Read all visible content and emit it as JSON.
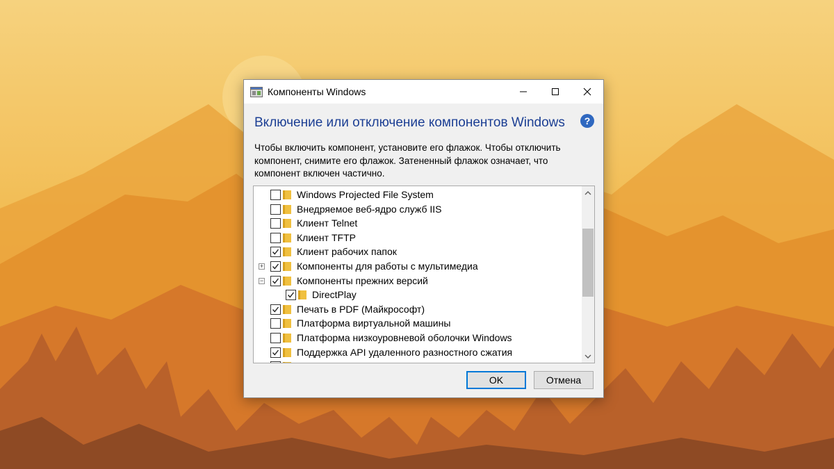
{
  "window": {
    "title": "Компоненты Windows",
    "heading": "Включение или отключение компонентов Windows",
    "description": "Чтобы включить компонент, установите его флажок. Чтобы отключить компонент, снимите его флажок. Затененный флажок означает, что компонент включен частично."
  },
  "features": [
    {
      "label": "Windows Projected File System",
      "checked": false,
      "expander": "",
      "level": 0
    },
    {
      "label": "Внедряемое веб-ядро служб IIS",
      "checked": false,
      "expander": "",
      "level": 0
    },
    {
      "label": "Клиент Telnet",
      "checked": false,
      "expander": "",
      "level": 0
    },
    {
      "label": "Клиент TFTP",
      "checked": false,
      "expander": "",
      "level": 0
    },
    {
      "label": "Клиент рабочих папок",
      "checked": true,
      "expander": "",
      "level": 0
    },
    {
      "label": "Компоненты для работы с мультимедиа",
      "checked": true,
      "expander": "plus",
      "level": 0
    },
    {
      "label": "Компоненты прежних версий",
      "checked": true,
      "expander": "minus",
      "level": 0
    },
    {
      "label": "DirectPlay",
      "checked": true,
      "expander": "",
      "level": 1
    },
    {
      "label": "Печать в PDF (Майкрософт)",
      "checked": true,
      "expander": "",
      "level": 0
    },
    {
      "label": "Платформа виртуальной машины",
      "checked": false,
      "expander": "",
      "level": 0
    },
    {
      "label": "Платформа низкоуровневой оболочки Windows",
      "checked": false,
      "expander": "",
      "level": 0
    },
    {
      "label": "Поддержка API удаленного разностного сжатия",
      "checked": true,
      "expander": "",
      "level": 0
    },
    {
      "label": "",
      "checked": false,
      "expander": "",
      "level": 0
    }
  ],
  "buttons": {
    "ok": "OK",
    "cancel": "Отмена"
  },
  "colors": {
    "heading": "#1c3f94",
    "folder": "#f0c040",
    "accent": "#0078d7"
  }
}
